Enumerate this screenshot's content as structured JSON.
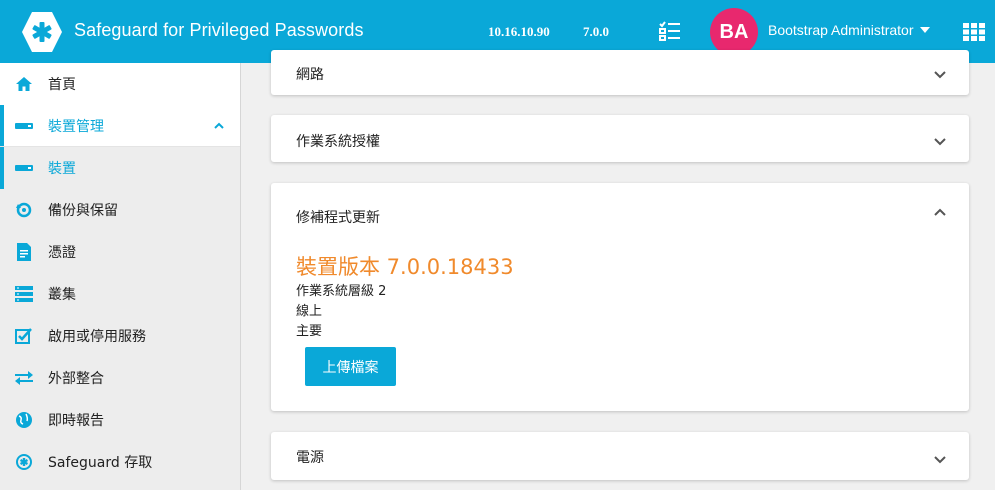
{
  "header": {
    "app_title": "Safeguard for Privileged Passwords",
    "ip": "10.16.10.90",
    "version": "7.0.0",
    "avatar_initials": "BA",
    "user_name": "Bootstrap Administrator"
  },
  "sidebar": {
    "items": [
      {
        "label": "首頁",
        "icon": "home-icon"
      },
      {
        "label": "裝置管理",
        "icon": "appliance-icon"
      },
      {
        "label": "裝置",
        "icon": "appliance-icon"
      },
      {
        "label": "備份與保留",
        "icon": "backup-icon"
      },
      {
        "label": "憑證",
        "icon": "certificate-icon"
      },
      {
        "label": "叢集",
        "icon": "cluster-icon"
      },
      {
        "label": "啟用或停用服務",
        "icon": "checkbox-edit-icon"
      },
      {
        "label": "外部整合",
        "icon": "exchange-arrows-icon"
      },
      {
        "label": "即時報告",
        "icon": "globe-icon"
      },
      {
        "label": "Safeguard 存取",
        "icon": "safeguard-icon"
      }
    ]
  },
  "cards": {
    "network": {
      "title": "網路"
    },
    "os_license": {
      "title": "作業系統授權"
    },
    "patch": {
      "title": "修補程式更新",
      "appliance_version": "裝置版本 7.0.0.18433",
      "os_level": "作業系統層級 2",
      "state": "線上",
      "role": "主要",
      "upload_label": "上傳檔案"
    },
    "power": {
      "title": "電源"
    }
  },
  "colors": {
    "accent": "#0aa8d8",
    "avatar": "#e8286e",
    "version_text": "#f08a2c"
  }
}
